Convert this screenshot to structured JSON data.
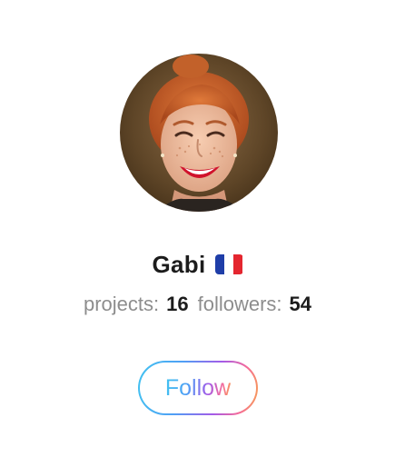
{
  "profile": {
    "name": "Gabi",
    "flag_icon": "france-flag-icon",
    "flag_colors": [
      "#1f3ea8",
      "#ffffff",
      "#e4262f"
    ],
    "avatar_icon": "profile-photo"
  },
  "stats": {
    "projects_label": "projects:",
    "projects_value": "16",
    "followers_label": "followers:",
    "followers_value": "54"
  },
  "actions": {
    "follow_label": "Follow"
  },
  "colors": {
    "name_text": "#1c1c1c",
    "muted_text": "#8d8d8d",
    "gradient": [
      "#41c3f0",
      "#4f9ff5",
      "#a35be8",
      "#f56a9a",
      "#f7a24d"
    ]
  }
}
